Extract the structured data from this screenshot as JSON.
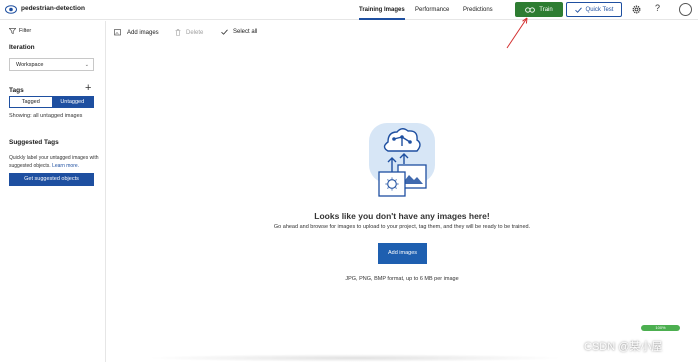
{
  "app": {
    "project_name": "pedestrian-detection"
  },
  "nav": {
    "tabs": [
      {
        "label": "Training Images",
        "active": true
      },
      {
        "label": "Performance"
      },
      {
        "label": "Predictions"
      }
    ]
  },
  "header_actions": {
    "train_label": "Train",
    "quick_test_label": "Quick Test",
    "help_symbol": "?"
  },
  "sidebar": {
    "filter_label": "Filter",
    "iteration_heading": "Iteration",
    "iteration_value": "Workspace",
    "tags_heading": "Tags",
    "tag_tabs": [
      {
        "label": "Tagged"
      },
      {
        "label": "Untagged",
        "active": true
      }
    ],
    "showing_text": "Showing: all untagged images",
    "suggested_heading": "Suggested Tags",
    "suggested_text": "Quickly label your untagged images with suggested objects.",
    "learn_more": "Learn more.",
    "suggested_button": "Get suggested objects"
  },
  "toolbar": {
    "add_images": "Add images",
    "delete": "Delete",
    "select_all": "Select all"
  },
  "empty_state": {
    "headline": "Looks like you don't have any images here!",
    "description": "Go ahead and browse for images to upload to your project, tag them, and they will be ready to be trained.",
    "button_label": "Add images",
    "formats": "JPG, PNG, BMP format, up to 6 MB per image"
  },
  "progress": {
    "text": "100%",
    "value": 1.0
  },
  "watermark": "CSDN @某小屋",
  "colors": {
    "accent": "#1e4fa0",
    "train_green": "#2e7d32",
    "annotation_red": "#d32f2f"
  }
}
